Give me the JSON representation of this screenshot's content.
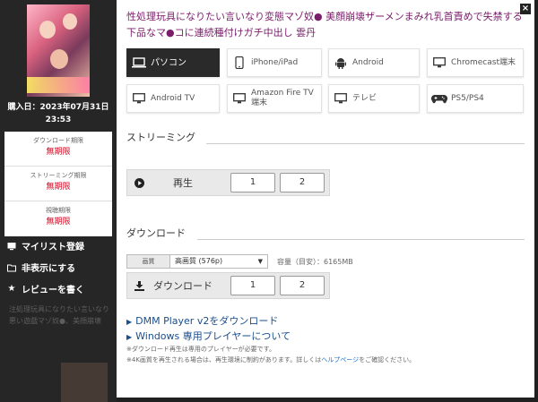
{
  "background": {
    "faint_lines": [
      "注処理玩具になりたい言いなり",
      "悪い遊戯マゾ奴●、美顔崩壊"
    ]
  },
  "left": {
    "purchase_label": "購入日：2023年07月31日",
    "purchase_time": "23:53",
    "limits": [
      {
        "label": "ダウンロード期限",
        "value": "無期限"
      },
      {
        "label": "ストリーミング期限",
        "value": "無期限"
      },
      {
        "label": "視聴期限",
        "value": "無期限"
      }
    ],
    "actions": [
      {
        "label": "マイリスト登録",
        "icon": "tv-icon"
      },
      {
        "label": "非表示にする",
        "icon": "folder-icon"
      },
      {
        "label": "レビューを書く",
        "icon": "star-icon"
      }
    ]
  },
  "modal": {
    "close_label": "×",
    "title": "性処理玩具になりたい言いなり変態マゾ奴● 美顔崩壊ザーメンまみれ乳首責めで失禁する下品なマ●コに連続種付けガチ中出し 雲丹",
    "devices": [
      {
        "label": "パソコン",
        "icon": "laptop-icon",
        "active": true
      },
      {
        "label": "iPhone/iPad",
        "icon": "phone-icon",
        "active": false
      },
      {
        "label": "Android",
        "icon": "android-icon",
        "active": false
      },
      {
        "label": "Chromecast端末",
        "icon": "monitor-icon",
        "active": false
      },
      {
        "label": "Android TV",
        "icon": "monitor-icon",
        "active": false
      },
      {
        "label": "Amazon Fire TV端末",
        "icon": "monitor-icon",
        "active": false
      },
      {
        "label": "テレビ",
        "icon": "monitor-icon",
        "active": false
      },
      {
        "label": "PS5/PS4",
        "icon": "gamepad-icon",
        "active": false
      }
    ],
    "streaming": {
      "heading": "ストリーミング",
      "play_label": "再生",
      "parts": [
        "1",
        "2"
      ]
    },
    "download": {
      "heading": "ダウンロード",
      "quality_tag": "画質",
      "quality_value": "高画質 (576p)",
      "size_text": "容量（目安）：6165MB",
      "button_label": "ダウンロード",
      "parts": [
        "1",
        "2"
      ]
    },
    "links": [
      "DMM Player v2をダウンロード",
      "Windows 専用プレイヤーについて"
    ],
    "notes": {
      "note1": "※ダウンロード再生は専用のプレイヤーが必要です。",
      "note2_prefix": "※4K画質を再生される場合は、再生環境に制約があります。詳しくは",
      "note2_link": "ヘルプページ",
      "note2_suffix": "をご確認ください。"
    }
  }
}
